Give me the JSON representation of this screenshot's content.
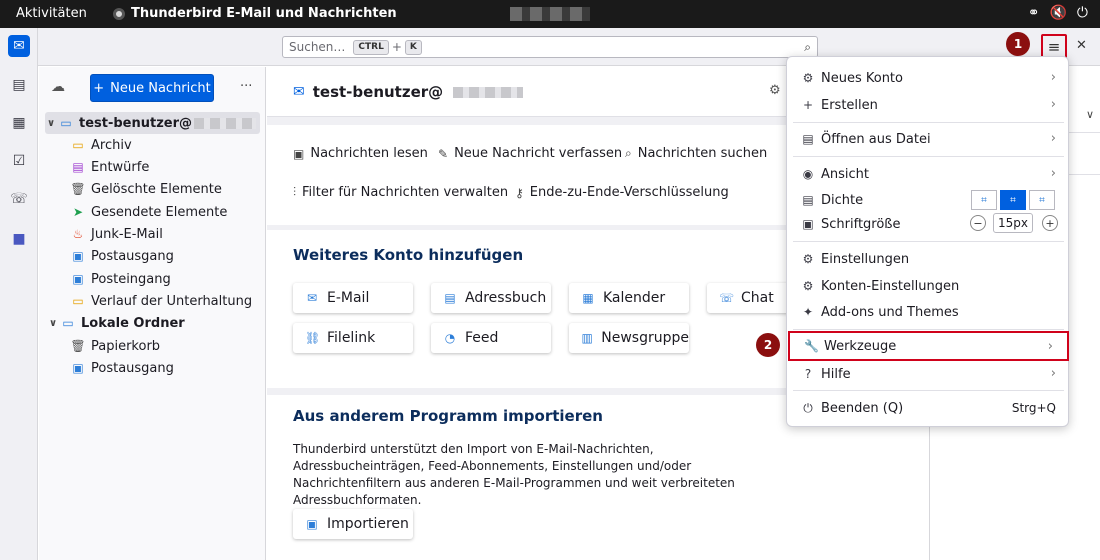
{
  "topbar": {
    "activities": "Aktivitäten",
    "app_title": "Thunderbird E-Mail und Nachrichten",
    "tray_icons": [
      "network-icon",
      "volume-muted-icon",
      "power-icon"
    ]
  },
  "spaces": {
    "items": [
      {
        "name": "mail",
        "icon": "✉"
      },
      {
        "name": "address-book",
        "icon": "▤"
      },
      {
        "name": "calendar",
        "icon": "▦"
      },
      {
        "name": "tasks",
        "icon": "☑"
      },
      {
        "name": "chat",
        "icon": "☏"
      },
      {
        "name": "teams",
        "icon": "■"
      }
    ]
  },
  "search": {
    "placeholder": "Suchen…",
    "key1": "CTRL",
    "plus": "+",
    "key2": "K"
  },
  "folderpane": {
    "new_message": "Neue Nachricht",
    "more": "···",
    "account": "test-benutzer@",
    "folders": [
      {
        "label": "Archiv",
        "icon": "▭"
      },
      {
        "label": "Entwürfe",
        "icon": "▤"
      },
      {
        "label": "Gelöschte Elemente",
        "icon": "🗑"
      },
      {
        "label": "Gesendete Elemente",
        "icon": "➤"
      },
      {
        "label": "Junk-E-Mail",
        "icon": "♨"
      },
      {
        "label": "Postausgang",
        "icon": "▣"
      },
      {
        "label": "Posteingang",
        "icon": "▣"
      },
      {
        "label": "Verlauf der Unterhaltung",
        "icon": "▭"
      }
    ],
    "local": "Lokale Ordner",
    "local_folders": [
      {
        "label": "Papierkorb",
        "icon": "🗑"
      },
      {
        "label": "Postausgang",
        "icon": "▣"
      }
    ]
  },
  "main": {
    "account_title": "test-benutzer@",
    "actions": [
      {
        "label": "Nachrichten lesen",
        "icon": "▣"
      },
      {
        "label": "Neue Nachricht verfassen",
        "icon": "✎"
      },
      {
        "label": "Nachrichten suchen",
        "icon": "⌕"
      },
      {
        "label": "Filter für Nachrichten verwalten",
        "icon": "⫶"
      },
      {
        "label": "Ende-zu-Ende-Verschlüsselung",
        "icon": "⚷"
      }
    ],
    "add_account_title": "Weiteres Konto hinzufügen",
    "tiles": [
      {
        "label": "E-Mail",
        "icon": "✉"
      },
      {
        "label": "Adressbuch",
        "icon": "▤"
      },
      {
        "label": "Kalender",
        "icon": "▦"
      },
      {
        "label": "Chat",
        "icon": "☏"
      },
      {
        "label": "Filelink",
        "icon": "⛓"
      },
      {
        "label": "Feed",
        "icon": "◔"
      },
      {
        "label": "Newsgruppe",
        "icon": "▥"
      }
    ],
    "import_title": "Aus anderem Programm importieren",
    "import_desc": "Thunderbird unterstützt den Import von E-Mail-Nachrichten, Adressbucheinträgen, Feed-Abonnements, Einstellungen und/oder Nachrichtenfiltern aus anderen E-Mail-Programmen und weit verbreiteten Adressbuchformaten.",
    "import_button": "Importieren"
  },
  "appmenu": {
    "items": [
      {
        "label": "Neues Konto",
        "icon": "⚙"
      },
      {
        "label": "Erstellen",
        "icon": "+"
      },
      {
        "label": "Öffnen aus Datei",
        "icon": "▤"
      },
      {
        "label": "Ansicht",
        "icon": "◉"
      },
      {
        "label": "Dichte",
        "icon": "▤"
      },
      {
        "label": "Schriftgröße",
        "icon": "▣"
      },
      {
        "label": "Einstellungen",
        "icon": "⚙"
      },
      {
        "label": "Konten-Einstellungen",
        "icon": "⚙"
      },
      {
        "label": "Add-ons und Themes",
        "icon": "✦"
      },
      {
        "label": "Werkzeuge",
        "icon": "🔧"
      },
      {
        "label": "Hilfe",
        "icon": "?"
      },
      {
        "label": "Beenden (Q)",
        "icon": "⏻"
      }
    ],
    "font_size": "15px",
    "quit_shortcut": "Strg+Q"
  },
  "badges": [
    "1",
    "2"
  ],
  "colors": {
    "accent": "#0060df",
    "highlight": "#d0021b",
    "badge": "#8b0f0f"
  }
}
